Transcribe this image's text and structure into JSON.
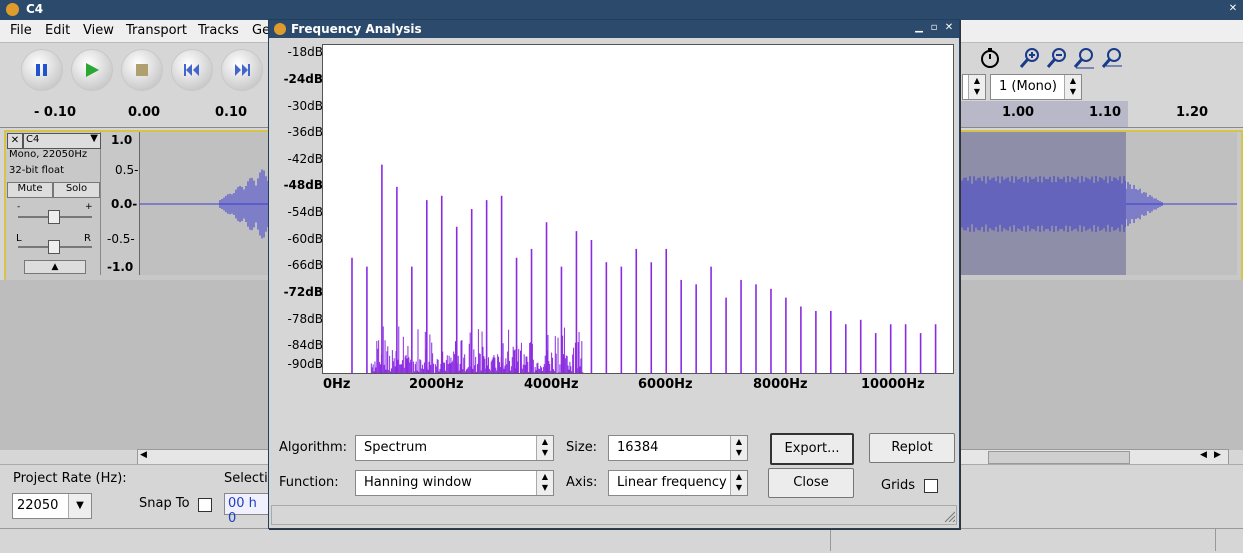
{
  "window": {
    "title": "C4"
  },
  "menu": [
    "File",
    "Edit",
    "View",
    "Transport",
    "Tracks",
    "Ge"
  ],
  "ruler": {
    "ticks": [
      "- 0.10",
      "0.00",
      "0.10",
      "1.00",
      "1.10",
      "1.20"
    ]
  },
  "toolbar": {
    "channels_value": "1 (Mono)"
  },
  "track": {
    "name": "C4",
    "info1": "Mono, 22050Hz",
    "info2": "32-bit float",
    "mute": "Mute",
    "solo": "Solo",
    "gain_minus": "-",
    "gain_plus": "+",
    "pan_left": "L",
    "pan_right": "R",
    "scale": [
      "1.0",
      "0.5-",
      "0.0-",
      "-0.5-",
      "-1.0"
    ]
  },
  "bottom": {
    "project_rate_label": "Project Rate (Hz):",
    "project_rate_value": "22050",
    "snap_to_label": "Snap To",
    "selection_label": "Selecti",
    "selection_value": "00 h 0"
  },
  "dialog": {
    "title": "Frequency Analysis",
    "algorithm_label": "Algorithm:",
    "algorithm_value": "Spectrum",
    "size_label": "Size:",
    "size_value": "16384",
    "function_label": "Function:",
    "function_value": "Hanning window",
    "axis_label": "Axis:",
    "axis_value": "Linear frequency",
    "export_label": "Export...",
    "replot_label": "Replot",
    "close_label": "Close",
    "grids_label": "Grids",
    "grids_checked": false
  },
  "chart_data": {
    "type": "bar",
    "color": "#8a2be2",
    "ylim": [
      -91,
      -17
    ],
    "xlim": [
      0,
      11000
    ],
    "y_ticks": [
      "-18dB",
      "-24dB",
      "-30dB",
      "-36dB",
      "-42dB",
      "-48dB",
      "-54dB",
      "-60dB",
      "-66dB",
      "-72dB",
      "-78dB",
      "-84dB",
      "-90dB"
    ],
    "x_ticks": [
      "0Hz",
      "2000Hz",
      "4000Hz",
      "6000Hz",
      "8000Hz",
      "10000Hz"
    ],
    "peaks": {
      "x": [
        262,
        523,
        785,
        1047,
        1308,
        1570,
        1831,
        2093,
        2355,
        2616,
        2878,
        3139,
        3401,
        3663,
        3924,
        4186,
        4448,
        4709,
        4971,
        5232,
        5494,
        5756,
        6017,
        6279,
        6540,
        6802,
        7064,
        7325,
        7587,
        7848,
        8110,
        8372,
        8633,
        8895,
        9156,
        9418,
        9680,
        9941,
        10203,
        10465
      ],
      "y": [
        -65,
        -67,
        -44,
        -49,
        -67,
        -52,
        -51,
        -58,
        -54,
        -52,
        -51,
        -65,
        -63,
        -57,
        -67,
        -59,
        -61,
        -66,
        -67,
        -63,
        -66,
        -63,
        -70,
        -71,
        -67,
        -74,
        -70,
        -71,
        -72,
        -74,
        -76,
        -77,
        -77,
        -80,
        -79,
        -82,
        -80,
        -80,
        -82,
        -80
      ]
    },
    "noise_floor_range_hz": [
      600,
      4300
    ],
    "noise_floor_level_db": [
      -91,
      -80
    ]
  }
}
